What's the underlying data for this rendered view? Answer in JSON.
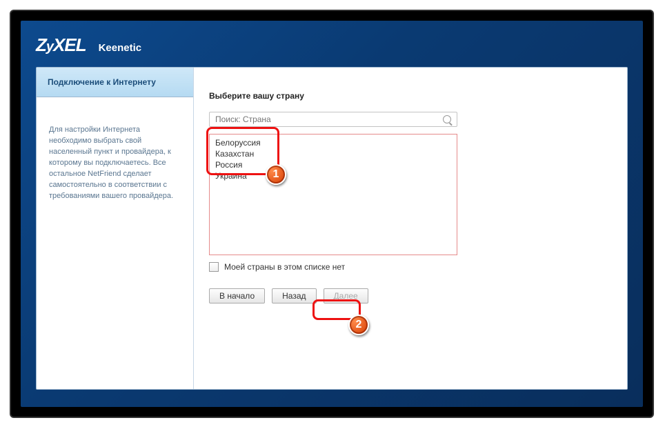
{
  "header": {
    "brand": "ZyXEL",
    "model": "Keenetic"
  },
  "sidebar": {
    "step_title": "Подключение к Интернету",
    "help_text": "Для настройки Интернета необходимо выбрать свой населенный пункт и провайдера, к которому вы подключаетесь. Все остальное NetFriend сделает самостоятельно в соответствии с требованиями вашего провайдера."
  },
  "main": {
    "heading": "Выберите вашу страну",
    "search_placeholder": "Поиск: Страна",
    "countries": [
      "Белоруссия",
      "Казахстан",
      "Россия",
      "Украина"
    ],
    "not_listed_label": "Моей страны в этом списке нет",
    "buttons": {
      "home": "В начало",
      "back": "Назад",
      "next": "Далее"
    }
  },
  "annotations": {
    "badge1": "1",
    "badge2": "2"
  }
}
